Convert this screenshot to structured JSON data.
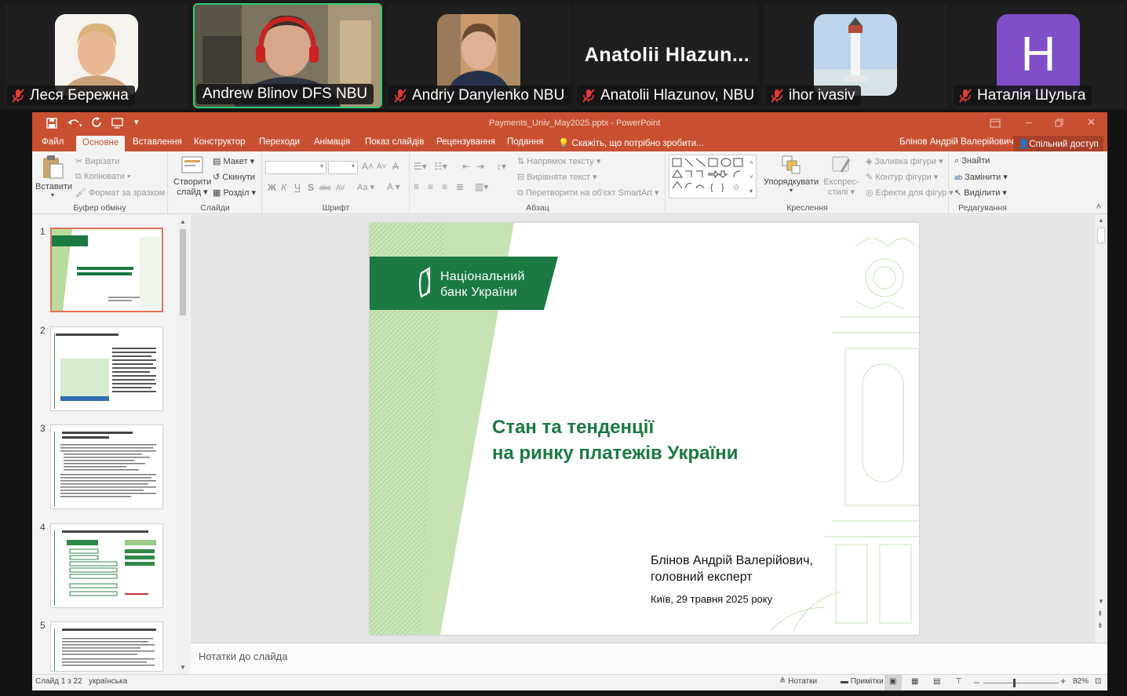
{
  "participants": [
    {
      "name": "Леся Бережна",
      "muted": true
    },
    {
      "name": "Andrew Blinov DFS NBU",
      "muted": false,
      "active_speaker": true
    },
    {
      "name": "Andriy Danylenko NBU",
      "muted": true
    },
    {
      "name": "Anatolii Hlazunov, NBU",
      "muted": true,
      "display_text": "Anatolii  Hlazun..."
    },
    {
      "name": "ihor ivasiv",
      "muted": true
    },
    {
      "name": "Наталія Шульга",
      "muted": true,
      "initial": "H",
      "avatar_color": "#7e4fc8"
    }
  ],
  "window": {
    "filename": "Payments_Univ_May2025.pptx - PowerPoint",
    "user": "Блінов Андрій Валерійович",
    "share": "Спільний доступ",
    "tell_me": "Скажіть, що потрібно зробити..."
  },
  "tabs": [
    "Файл",
    "Основне",
    "Вставлення",
    "Конструктор",
    "Переходи",
    "Анімація",
    "Показ слайдів",
    "Рецензування",
    "Подання"
  ],
  "selected_tab": "Основне",
  "ribbon": {
    "clipboard": {
      "paste": "Вставити",
      "cut": "Вирізати",
      "copy": "Копіювати",
      "format": "Формат за зразком",
      "label": "Буфер обміну"
    },
    "slides": {
      "new": "Створити",
      "new2": "слайд",
      "layout": "Макет",
      "reset": "Скинути",
      "section": "Розділ",
      "label": "Слайди"
    },
    "font": {
      "label": "Шрифт",
      "bold": "Ж",
      "italic": "К",
      "underline": "Ч",
      "shadow": "S",
      "strike": "abc",
      "spacing": "AV",
      "case": "Aa",
      "grow": "A",
      "shrink": "A",
      "clear": "A",
      "color": "A"
    },
    "paragraph": {
      "direction": "Напрямок тексту",
      "align": "Вирівняти текст",
      "smartart": "Перетворити на об'єкт SmartArt",
      "label": "Абзац"
    },
    "drawing": {
      "arrange": "Упорядкувати",
      "quick1": "Експрес-",
      "quick2": "стилі",
      "fill": "Заливка фігури",
      "outline": "Контур фігури",
      "effects": "Ефекти для фігур",
      "label": "Креслення"
    },
    "editing": {
      "find": "Знайти",
      "replace": "Замінити",
      "select": "Виділити",
      "label": "Редагування"
    }
  },
  "thumbnails": [
    {
      "num": "1",
      "title": "Стан та тенденції на ринку платежів України"
    },
    {
      "num": "2",
      "title": "Фінансова стабільність – що таке і чому платежі"
    },
    {
      "num": "3",
      "title": "Роль платіжної інфраструктури фінансових установ"
    },
    {
      "num": "4",
      "title": "Закон України «Про платіжні послуги»"
    },
    {
      "num": "5",
      "title": "Платіжні ризики інфраструктури фінансового ринку"
    }
  ],
  "slide": {
    "logo_line1": "Національний",
    "logo_line2": "банк України",
    "title_line1": "Стан та тенденції",
    "title_line2": "на ринку платежів України",
    "author_line1": "Блінов Андрій Валерійович,",
    "author_line2": "головний експерт",
    "place_date": "Київ, 29 травня 2025 року"
  },
  "notes_placeholder": "Нотатки до слайда",
  "status": {
    "slide_info": "Слайд 1 з 22",
    "language": "українська",
    "notes": "Нотатки",
    "comments": "Примітки",
    "zoom": "82%",
    "zoom_level": 0.41
  },
  "colors": {
    "accent": "#c85031",
    "nbu_green": "#1a7a42",
    "speaker_border": "#2ecc71"
  }
}
